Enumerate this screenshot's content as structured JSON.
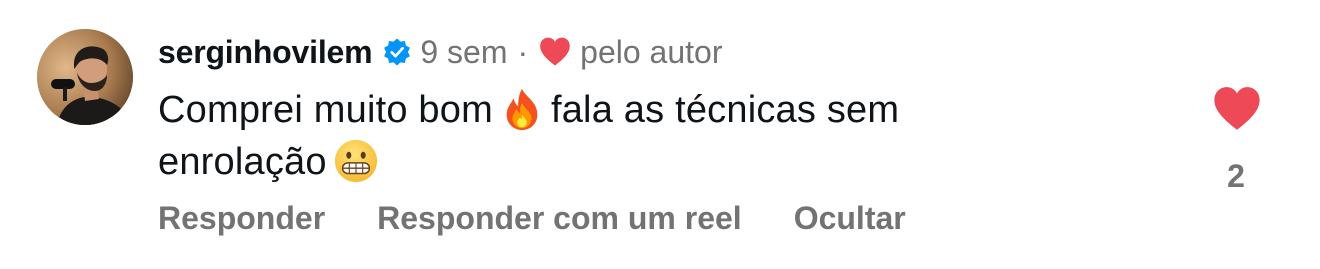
{
  "comment": {
    "author": "serginhovilem",
    "time": "9 sem",
    "separator": "·",
    "liked_by_author_label": "pelo autor",
    "text_part1": "Comprei muito bom",
    "text_part2": "fala as técnicas  sem",
    "text_part3": "enrolação",
    "emoji_1": "fire-emoji",
    "emoji_2": "grimacing-face-emoji",
    "like_count": "2"
  },
  "actions": {
    "reply_label": "Responder",
    "reply_reel_label": "Responder com um reel",
    "hide_label": "Ocultar"
  },
  "colors": {
    "heart_red": "#ed4956",
    "verified_blue": "#0095f6",
    "muted_text": "#737373",
    "primary_text": "#0f1419"
  },
  "icons": {
    "verified": "verified-badge-icon",
    "author_heart": "heart-icon",
    "like_button": "heart-filled-icon"
  }
}
